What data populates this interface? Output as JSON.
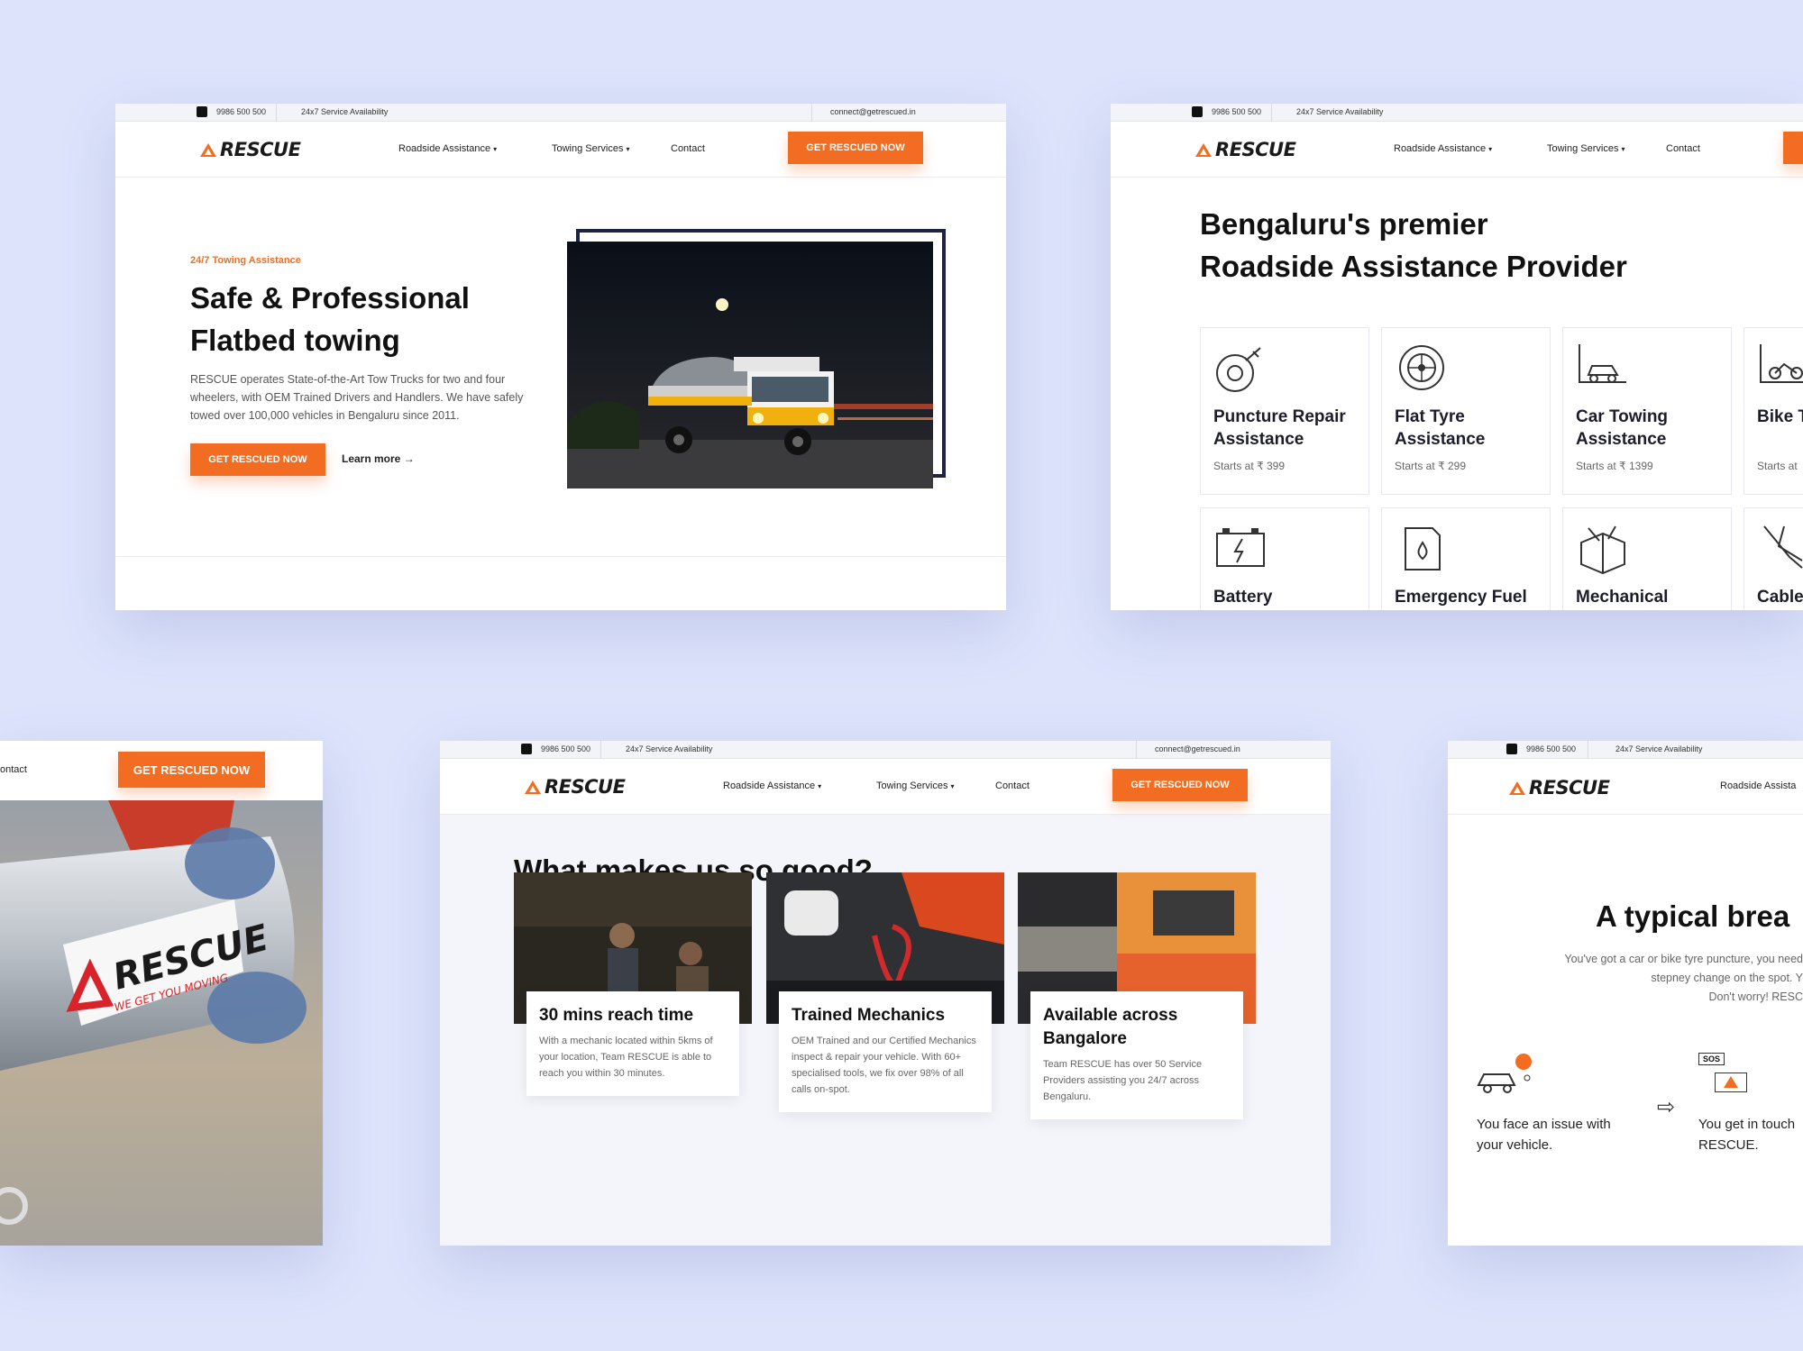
{
  "topbar": {
    "phone": "9986 500 500",
    "availability": "24x7 Service Availability",
    "email": "connect@getrescued.in"
  },
  "nav": {
    "logo": "RESCUE",
    "roadside": "Roadside Assistance",
    "towing": "Towing Services",
    "contact": "Contact",
    "cta": "GET RESCUED NOW"
  },
  "hero": {
    "eyebrow": "24/7 Towing Assistance",
    "title_line1": "Safe & Professional",
    "title_line2": "Flatbed towing",
    "body": "RESCUE operates State-of-the-Art Tow Trucks for two and four wheelers, with OEM Trained Drivers and Handlers. We have safely towed over 100,000 vehicles in Bengaluru since 2011.",
    "cta": "GET RESCUED NOW",
    "learn_more": "Learn more"
  },
  "services": {
    "title_line1": "Bengaluru's premier",
    "title_line2": "Roadside Assistance Provider",
    "items": [
      {
        "title": "Puncture Repair Assistance",
        "price": "Starts at ₹ 399",
        "icon": "tyre-repair-icon"
      },
      {
        "title": "Flat Tyre Assistance",
        "price": "Starts at ₹ 299",
        "icon": "tyre-icon"
      },
      {
        "title": "Car Towing Assistance",
        "price": "Starts at ₹ 1399",
        "icon": "car-tow-icon"
      },
      {
        "title": "Bike T Assis",
        "price": "Starts at",
        "icon": "bike-tow-icon"
      },
      {
        "title": "Battery",
        "icon": "battery-icon"
      },
      {
        "title": "Emergency Fuel",
        "icon": "fuel-can-icon"
      },
      {
        "title": "Mechanical",
        "icon": "toolbox-icon"
      },
      {
        "title": "Cable",
        "icon": "jumper-cable-icon"
      }
    ]
  },
  "brand_card": {
    "contact": "ontact",
    "cta": "GET RESCUED NOW",
    "logo_text": "RESCUE",
    "tagline": "WE GET YOU MOVING"
  },
  "features": {
    "title": "What makes us so good?",
    "items": [
      {
        "title": "30 mins reach time",
        "desc": "With a mechanic located within 5kms of your location, Team RESCUE is able to reach you within 30 minutes."
      },
      {
        "title": "Trained Mechanics",
        "desc": "OEM Trained and our Certified Mechanics inspect & repair your vehicle. With 60+ specialised tools, we fix over 98% of all calls on-spot."
      },
      {
        "title": "Available across Bangalore",
        "desc": "Team RESCUE has over 50 Service Providers assisting you 24/7 across Bengaluru."
      }
    ]
  },
  "breakdown": {
    "nav_item": "Roadside Assista",
    "title": "A typical brea",
    "line1": "You've got a car or bike tyre puncture, you need",
    "line2": "stepney change on the spot. Y",
    "line3": "Don't worry! RESC",
    "step1": "You face an issue with your vehicle.",
    "step2": "You get in touch RESCUE.",
    "sos": "SOS"
  },
  "colors": {
    "accent": "#f26d21",
    "background": "#dde3fb"
  }
}
